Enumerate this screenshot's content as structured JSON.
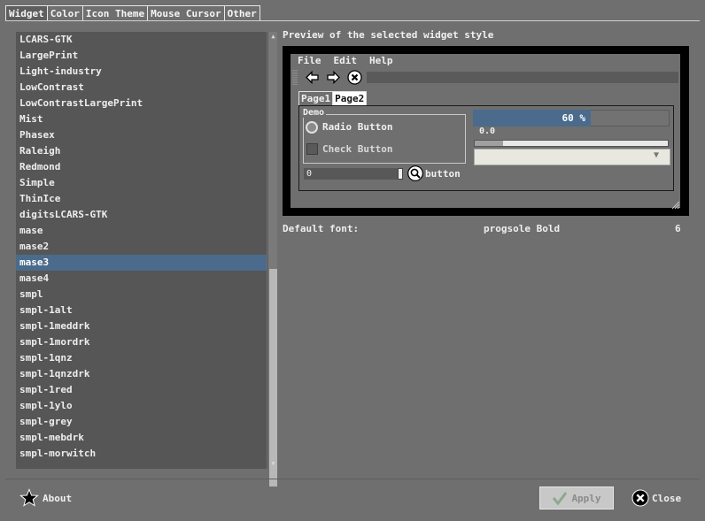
{
  "tabs": [
    {
      "label": "Widget",
      "active": true
    },
    {
      "label": "Color",
      "active": false
    },
    {
      "label": "Icon Theme",
      "active": false
    },
    {
      "label": "Mouse Cursor",
      "active": false
    },
    {
      "label": "Other",
      "active": false
    }
  ],
  "theme_list": {
    "selected": "mase3",
    "items": [
      "LCARS-GTK",
      "LargePrint",
      "Light-industry",
      "LowContrast",
      "LowContrastLargePrint",
      "Mist",
      "Phasex",
      "Raleigh",
      "Redmond",
      "Simple",
      "ThinIce",
      "digitsLCARS-GTK",
      "mase",
      "mase2",
      "mase3",
      "mase4",
      "smpl",
      "smpl-1alt",
      "smpl-1meddrk",
      "smpl-1mordrk",
      "smpl-1qnz",
      "smpl-1qnzdrk",
      "smpl-1red",
      "smpl-1ylo",
      "smpl-grey",
      "smpl-mebdrk",
      "smpl-morwitch"
    ]
  },
  "preview": {
    "label": "Preview of the selected widget style",
    "menu": [
      "File",
      "Edit",
      "Help"
    ],
    "toolbar_icons": [
      "arrow-left-icon",
      "arrow-right-icon",
      "stop-icon"
    ],
    "notebook_tabs": [
      {
        "label": "Page1",
        "active": false
      },
      {
        "label": "Page2",
        "active": true
      }
    ],
    "demo_frame_label": "Demo",
    "radio_label": "Radio Button",
    "check_label": "Check Button",
    "spin_value": "0",
    "button_label": "button",
    "progress_text": "60 %",
    "progress_fraction": 0.6,
    "scale_value": "0.0"
  },
  "default_font": {
    "label": "Default font:",
    "name": "progsole Bold",
    "size": "6"
  },
  "buttons": {
    "about": "About",
    "apply": "Apply",
    "close": "Close"
  },
  "colors": {
    "selection": "#4a6b8b",
    "background": "#6f6f6f",
    "list_bg": "#565656"
  }
}
